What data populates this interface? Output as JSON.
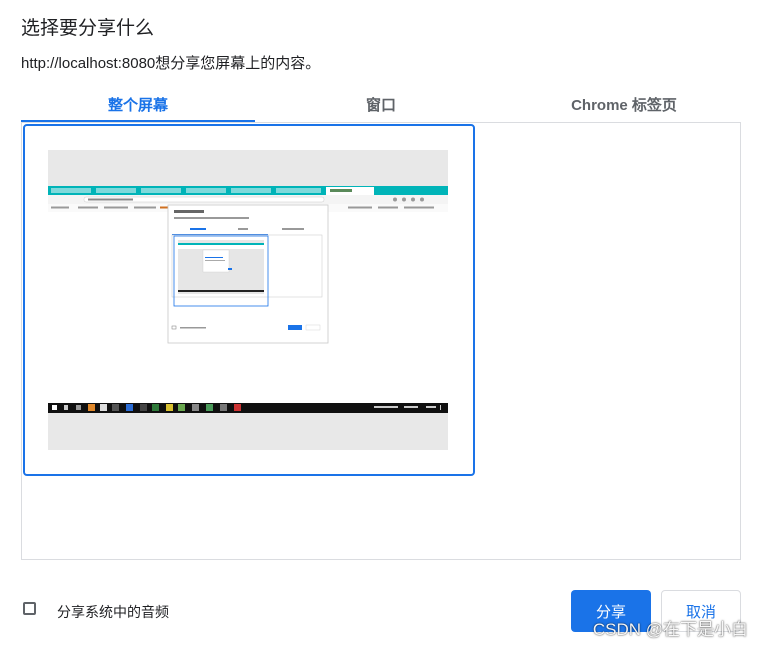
{
  "dialog": {
    "title": "选择要分享什么",
    "subtitle": "http://localhost:8080想分享您屏幕上的内容。"
  },
  "tabs": [
    {
      "label": "整个屏幕",
      "active": true
    },
    {
      "label": "窗口",
      "active": false
    },
    {
      "label": "Chrome 标签页",
      "active": false
    }
  ],
  "footer": {
    "audio_checkbox_label": "分享系统中的音频",
    "audio_checked": false,
    "share_label": "分享",
    "cancel_label": "取消"
  },
  "watermark": "CSDN @在下是小白",
  "colors": {
    "accent": "#1a73e8",
    "border": "#dadce0",
    "thumb_bg": "#e8e8e8",
    "browser_tabbar": "#00b4b8",
    "taskbar": "#101010"
  }
}
